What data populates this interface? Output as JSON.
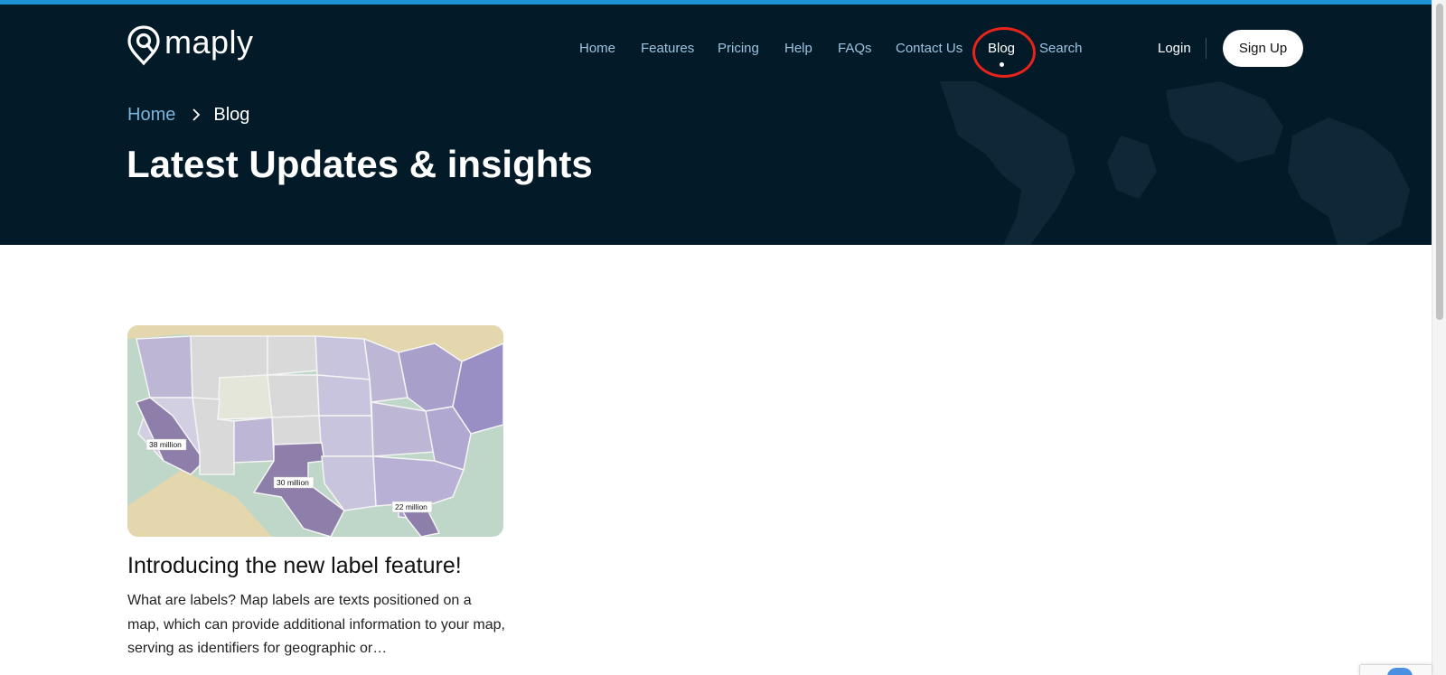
{
  "brand": {
    "name": "maply",
    "logo_icon": "map-pin-icon"
  },
  "nav": {
    "items": [
      {
        "label": "Home"
      },
      {
        "label": "Features"
      },
      {
        "label": "Pricing"
      },
      {
        "label": "Help"
      },
      {
        "label": "FAQs"
      },
      {
        "label": "Contact Us"
      },
      {
        "label": "Blog",
        "active": true
      },
      {
        "label": "Search"
      }
    ],
    "login_label": "Login",
    "signup_label": "Sign Up"
  },
  "breadcrumb": {
    "home": "Home",
    "current": "Blog",
    "separator_icon": "chevron-right-icon"
  },
  "page_title": "Latest Updates & insights",
  "posts": [
    {
      "title": "Introducing the new label feature!",
      "excerpt": "What are labels? Map labels are texts positioned on a map, which can provide additional information to your map, serving as identifiers for geographic or…",
      "image": {
        "labels": [
          "38 million",
          "30 million",
          "22 million"
        ]
      }
    }
  ],
  "colors": {
    "hero_bg": "#031b29",
    "accent_bar": "#1e93d6",
    "nav_link": "#9ec2e0",
    "breadcrumb_link": "#7ab4dd",
    "annotation": "#e8241a"
  }
}
